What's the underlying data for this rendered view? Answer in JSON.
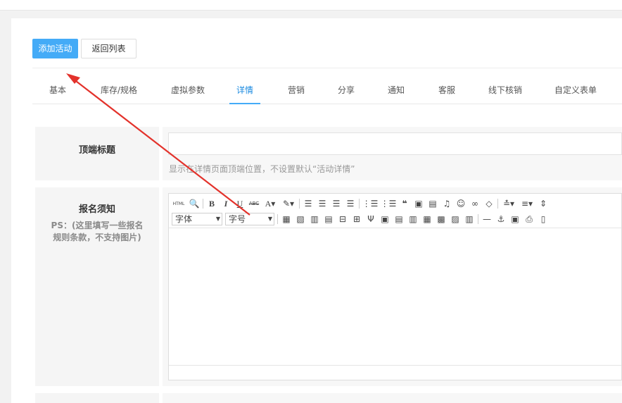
{
  "buttons": {
    "add": "添加活动",
    "back": "返回列表"
  },
  "tabs": [
    {
      "label": "基本",
      "active": false
    },
    {
      "label": "库存/规格",
      "active": false
    },
    {
      "label": "虚拟参数",
      "active": false
    },
    {
      "label": "详情",
      "active": true
    },
    {
      "label": "营销",
      "active": false
    },
    {
      "label": "分享",
      "active": false
    },
    {
      "label": "通知",
      "active": false
    },
    {
      "label": "客服",
      "active": false
    },
    {
      "label": "线下核销",
      "active": false
    },
    {
      "label": "自定义表单",
      "active": false
    }
  ],
  "top_title": {
    "label": "顶端标题",
    "value": "",
    "help": "显示在详情页面顶端位置，不设置默认“活动详情”"
  },
  "notice": {
    "label": "报名须知",
    "ps_line1": "PS：(这里填写一些报名",
    "ps_line2": "规则条款，不支持图片)"
  },
  "editor": {
    "font_select": "字体",
    "size_select": "字号",
    "toolbar_row1": [
      "html-icon",
      "preview-icon",
      "bold-icon",
      "italic-icon",
      "underline-icon",
      "strikethrough-icon",
      "font-color-icon",
      "highlight-icon",
      "align-left-icon",
      "align-center-icon",
      "align-right-icon",
      "align-justify-icon",
      "ordered-list-icon",
      "unordered-list-icon",
      "quote-icon",
      "image-icon",
      "video-icon",
      "music-icon",
      "emoji-icon",
      "link-icon",
      "eraser-icon",
      "line-height-icon",
      "paragraph-spacing-icon",
      "indent-icon"
    ],
    "toolbar_row2": [
      "table-icon",
      "table-props-icon",
      "insert-row-icon",
      "insert-col-icon",
      "delete-row-icon",
      "delete-col-icon",
      "split-cell-icon",
      "merge-cells-icon",
      "merge-right-icon",
      "merge-down-icon",
      "split-rows-icon",
      "split-cols-icon",
      "cell-props-icon",
      "table-del-icon",
      "horizontal-rule-icon",
      "anchor-icon",
      "template-icon",
      "print-icon",
      "paste-icon"
    ]
  },
  "colors": {
    "primary": "#44abf7",
    "active_tab": "#1a8ae0",
    "arrow": "#e3322b"
  }
}
